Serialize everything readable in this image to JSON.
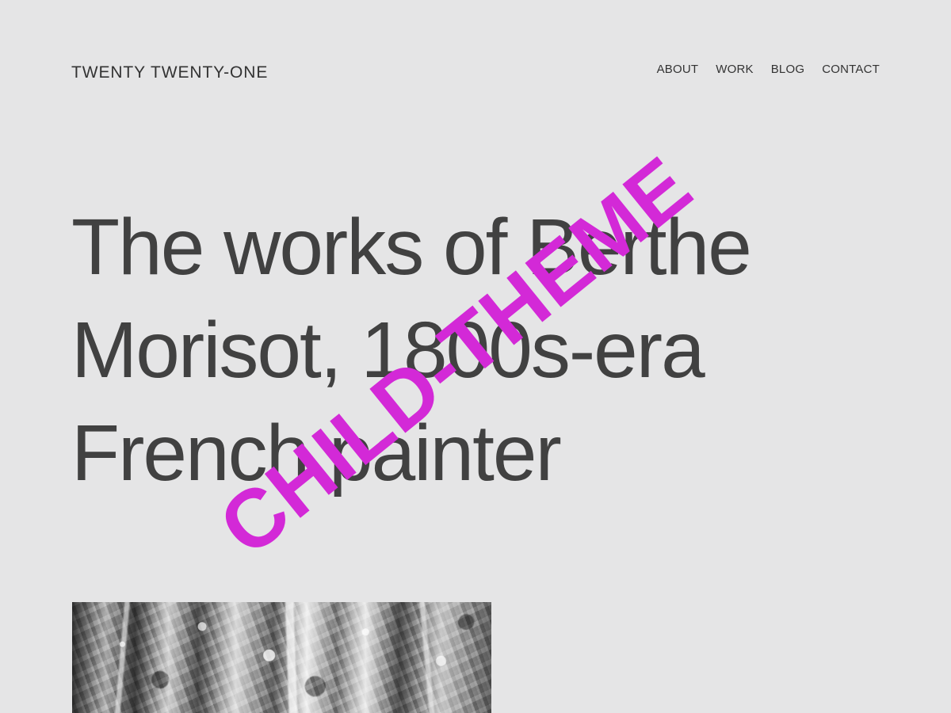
{
  "header": {
    "site_title": "TWENTY TWENTY-ONE",
    "nav": [
      {
        "label": "ABOUT"
      },
      {
        "label": "WORK"
      },
      {
        "label": "BLOG"
      },
      {
        "label": "CONTACT"
      }
    ]
  },
  "main": {
    "hero_title_lines": [
      "The works of Berthe",
      "Morisot, 1800s-era",
      "French painter"
    ]
  },
  "overlay": {
    "watermark": "CHILD-THEME"
  },
  "colors": {
    "background": "#e5e5e6",
    "text": "#414141",
    "watermark": "#d329d7"
  }
}
